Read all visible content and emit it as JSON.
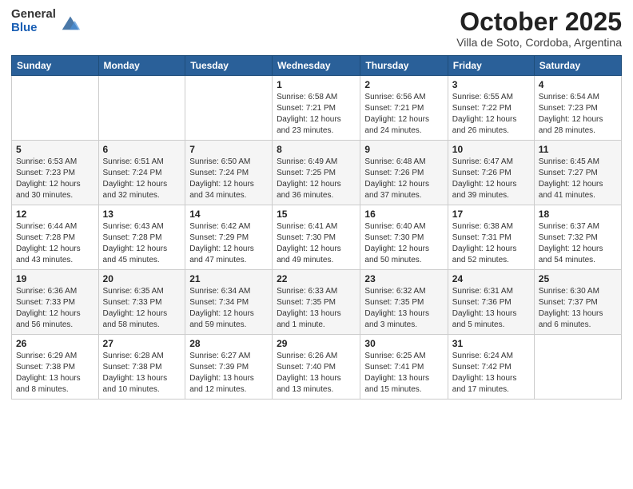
{
  "logo": {
    "general": "General",
    "blue": "Blue"
  },
  "header": {
    "month": "October 2025",
    "location": "Villa de Soto, Cordoba, Argentina"
  },
  "weekdays": [
    "Sunday",
    "Monday",
    "Tuesday",
    "Wednesday",
    "Thursday",
    "Friday",
    "Saturday"
  ],
  "weeks": [
    [
      {
        "day": "",
        "info": ""
      },
      {
        "day": "",
        "info": ""
      },
      {
        "day": "",
        "info": ""
      },
      {
        "day": "1",
        "info": "Sunrise: 6:58 AM\nSunset: 7:21 PM\nDaylight: 12 hours and 23 minutes."
      },
      {
        "day": "2",
        "info": "Sunrise: 6:56 AM\nSunset: 7:21 PM\nDaylight: 12 hours and 24 minutes."
      },
      {
        "day": "3",
        "info": "Sunrise: 6:55 AM\nSunset: 7:22 PM\nDaylight: 12 hours and 26 minutes."
      },
      {
        "day": "4",
        "info": "Sunrise: 6:54 AM\nSunset: 7:23 PM\nDaylight: 12 hours and 28 minutes."
      }
    ],
    [
      {
        "day": "5",
        "info": "Sunrise: 6:53 AM\nSunset: 7:23 PM\nDaylight: 12 hours and 30 minutes."
      },
      {
        "day": "6",
        "info": "Sunrise: 6:51 AM\nSunset: 7:24 PM\nDaylight: 12 hours and 32 minutes."
      },
      {
        "day": "7",
        "info": "Sunrise: 6:50 AM\nSunset: 7:24 PM\nDaylight: 12 hours and 34 minutes."
      },
      {
        "day": "8",
        "info": "Sunrise: 6:49 AM\nSunset: 7:25 PM\nDaylight: 12 hours and 36 minutes."
      },
      {
        "day": "9",
        "info": "Sunrise: 6:48 AM\nSunset: 7:26 PM\nDaylight: 12 hours and 37 minutes."
      },
      {
        "day": "10",
        "info": "Sunrise: 6:47 AM\nSunset: 7:26 PM\nDaylight: 12 hours and 39 minutes."
      },
      {
        "day": "11",
        "info": "Sunrise: 6:45 AM\nSunset: 7:27 PM\nDaylight: 12 hours and 41 minutes."
      }
    ],
    [
      {
        "day": "12",
        "info": "Sunrise: 6:44 AM\nSunset: 7:28 PM\nDaylight: 12 hours and 43 minutes."
      },
      {
        "day": "13",
        "info": "Sunrise: 6:43 AM\nSunset: 7:28 PM\nDaylight: 12 hours and 45 minutes."
      },
      {
        "day": "14",
        "info": "Sunrise: 6:42 AM\nSunset: 7:29 PM\nDaylight: 12 hours and 47 minutes."
      },
      {
        "day": "15",
        "info": "Sunrise: 6:41 AM\nSunset: 7:30 PM\nDaylight: 12 hours and 49 minutes."
      },
      {
        "day": "16",
        "info": "Sunrise: 6:40 AM\nSunset: 7:30 PM\nDaylight: 12 hours and 50 minutes."
      },
      {
        "day": "17",
        "info": "Sunrise: 6:38 AM\nSunset: 7:31 PM\nDaylight: 12 hours and 52 minutes."
      },
      {
        "day": "18",
        "info": "Sunrise: 6:37 AM\nSunset: 7:32 PM\nDaylight: 12 hours and 54 minutes."
      }
    ],
    [
      {
        "day": "19",
        "info": "Sunrise: 6:36 AM\nSunset: 7:33 PM\nDaylight: 12 hours and 56 minutes."
      },
      {
        "day": "20",
        "info": "Sunrise: 6:35 AM\nSunset: 7:33 PM\nDaylight: 12 hours and 58 minutes."
      },
      {
        "day": "21",
        "info": "Sunrise: 6:34 AM\nSunset: 7:34 PM\nDaylight: 12 hours and 59 minutes."
      },
      {
        "day": "22",
        "info": "Sunrise: 6:33 AM\nSunset: 7:35 PM\nDaylight: 13 hours and 1 minute."
      },
      {
        "day": "23",
        "info": "Sunrise: 6:32 AM\nSunset: 7:35 PM\nDaylight: 13 hours and 3 minutes."
      },
      {
        "day": "24",
        "info": "Sunrise: 6:31 AM\nSunset: 7:36 PM\nDaylight: 13 hours and 5 minutes."
      },
      {
        "day": "25",
        "info": "Sunrise: 6:30 AM\nSunset: 7:37 PM\nDaylight: 13 hours and 6 minutes."
      }
    ],
    [
      {
        "day": "26",
        "info": "Sunrise: 6:29 AM\nSunset: 7:38 PM\nDaylight: 13 hours and 8 minutes."
      },
      {
        "day": "27",
        "info": "Sunrise: 6:28 AM\nSunset: 7:38 PM\nDaylight: 13 hours and 10 minutes."
      },
      {
        "day": "28",
        "info": "Sunrise: 6:27 AM\nSunset: 7:39 PM\nDaylight: 13 hours and 12 minutes."
      },
      {
        "day": "29",
        "info": "Sunrise: 6:26 AM\nSunset: 7:40 PM\nDaylight: 13 hours and 13 minutes."
      },
      {
        "day": "30",
        "info": "Sunrise: 6:25 AM\nSunset: 7:41 PM\nDaylight: 13 hours and 15 minutes."
      },
      {
        "day": "31",
        "info": "Sunrise: 6:24 AM\nSunset: 7:42 PM\nDaylight: 13 hours and 17 minutes."
      },
      {
        "day": "",
        "info": ""
      }
    ]
  ]
}
